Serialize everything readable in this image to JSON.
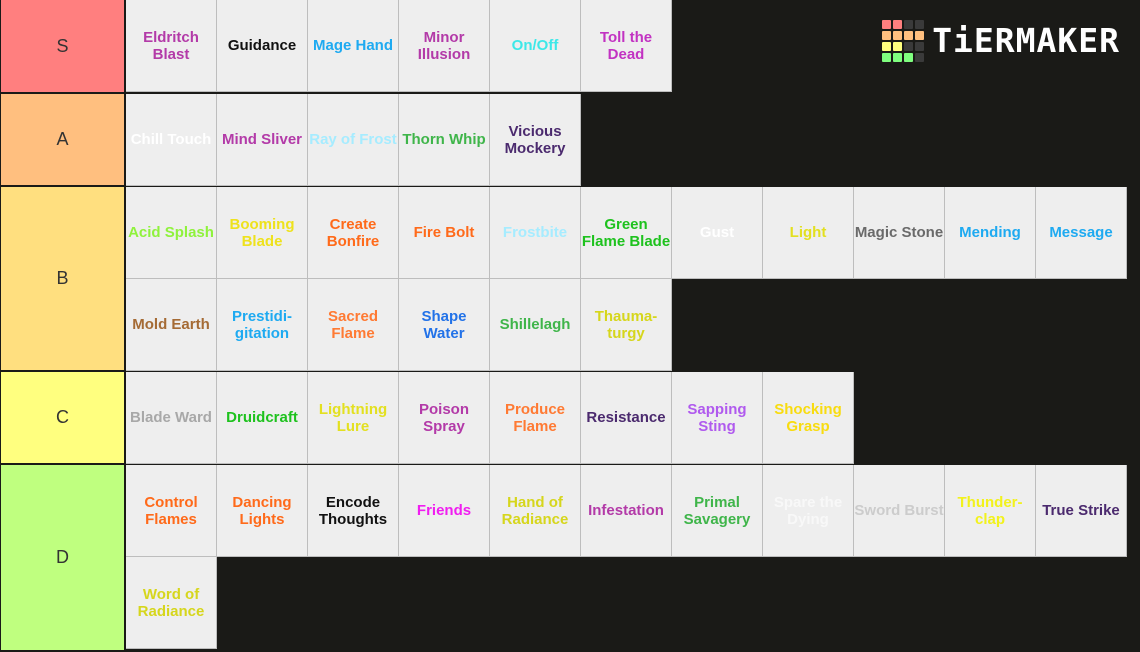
{
  "logo": {
    "text": "TiERMAKER",
    "grid_colors": [
      "#ff7f7f",
      "#ff7f7f",
      "#3a3a3a",
      "#3a3a3a",
      "#ffbf7f",
      "#ffbf7f",
      "#ffbf7f",
      "#ffbf7f",
      "#ffff7f",
      "#ffff7f",
      "#3a3a3a",
      "#3a3a3a",
      "#7fff7f",
      "#7fff7f",
      "#7fff7f",
      "#3a3a3a"
    ]
  },
  "tiers": [
    {
      "label": "S",
      "color": "#ff7f7f",
      "items": [
        {
          "name": "Eldritch Blast",
          "color": "#b33aa8"
        },
        {
          "name": "Guidance",
          "color": "#111111"
        },
        {
          "name": "Mage Hand",
          "color": "#1eaaf1"
        },
        {
          "name": "Minor Illusion",
          "color": "#b33aa8"
        },
        {
          "name": "On/Off",
          "color": "#3de8e8"
        },
        {
          "name": "Toll the Dead",
          "color": "#c232c2"
        }
      ]
    },
    {
      "label": "A",
      "color": "#ffbf7f",
      "items": [
        {
          "name": "Chill Touch",
          "color": "#ffffff"
        },
        {
          "name": "Mind Sliver",
          "color": "#b33aa8"
        },
        {
          "name": "Ray of Frost",
          "color": "#a6ecff"
        },
        {
          "name": "Thorn Whip",
          "color": "#3fb54a"
        },
        {
          "name": "Vicious Mockery",
          "color": "#4b2a6e"
        }
      ]
    },
    {
      "label": "B",
      "color": "#ffdf7f",
      "items": [
        {
          "name": "Acid Splash",
          "color": "#8ff23c"
        },
        {
          "name": "Booming Blade",
          "color": "#eee21c"
        },
        {
          "name": "Create Bonfire",
          "color": "#ff6a1a"
        },
        {
          "name": "Fire Bolt",
          "color": "#ff6a1a"
        },
        {
          "name": "Frostbite",
          "color": "#a6ecff"
        },
        {
          "name": "Green Flame Blade",
          "color": "#1ec21e"
        },
        {
          "name": "Gust",
          "color": "#ffffff"
        },
        {
          "name": "Light",
          "color": "#e3e020"
        },
        {
          "name": "Magic Stone",
          "color": "#6a6a6a"
        },
        {
          "name": "Mending",
          "color": "#1eaaf1"
        },
        {
          "name": "Message",
          "color": "#1eaaf1"
        },
        {
          "name": "Mold Earth",
          "color": "#a56b35"
        },
        {
          "name": "Prestidi-gitation",
          "color": "#1eaaf1"
        },
        {
          "name": "Sacred Flame",
          "color": "#ff7a33"
        },
        {
          "name": "Shape Water",
          "color": "#2272e8"
        },
        {
          "name": "Shillelagh",
          "color": "#3fb54a"
        },
        {
          "name": "Thauma-turgy",
          "color": "#d6d61c"
        }
      ]
    },
    {
      "label": "C",
      "color": "#ffff7f",
      "items": [
        {
          "name": "Blade Ward",
          "color": "#a8a8a8"
        },
        {
          "name": "Druidcraft",
          "color": "#1ec21e"
        },
        {
          "name": "Lightning Lure",
          "color": "#e3e020"
        },
        {
          "name": "Poison Spray",
          "color": "#b33aa8"
        },
        {
          "name": "Produce Flame",
          "color": "#ff7a33"
        },
        {
          "name": "Resistance",
          "color": "#4b2a6e"
        },
        {
          "name": "Sapping Sting",
          "color": "#b05aee"
        },
        {
          "name": "Shocking Grasp",
          "color": "#f8dc10"
        }
      ]
    },
    {
      "label": "D",
      "color": "#bfff7f",
      "items": [
        {
          "name": "Control Flames",
          "color": "#ff6a1a"
        },
        {
          "name": "Dancing Lights",
          "color": "#ff6a1a"
        },
        {
          "name": "Encode Thoughts",
          "color": "#111111"
        },
        {
          "name": "Friends",
          "color": "#f01ef0"
        },
        {
          "name": "Hand of Radiance",
          "color": "#d6d61c"
        },
        {
          "name": "Infestation",
          "color": "#b33aa8"
        },
        {
          "name": "Primal Savagery",
          "color": "#3fb54a"
        },
        {
          "name": "Spare the Dying",
          "color": "#f8f8f8"
        },
        {
          "name": "Sword Burst",
          "color": "#cccccc"
        },
        {
          "name": "Thunder-clap",
          "color": "#f2f21c"
        },
        {
          "name": "True Strike",
          "color": "#4b2a6e"
        },
        {
          "name": "Word of Radiance",
          "color": "#d6d61c"
        }
      ]
    }
  ]
}
